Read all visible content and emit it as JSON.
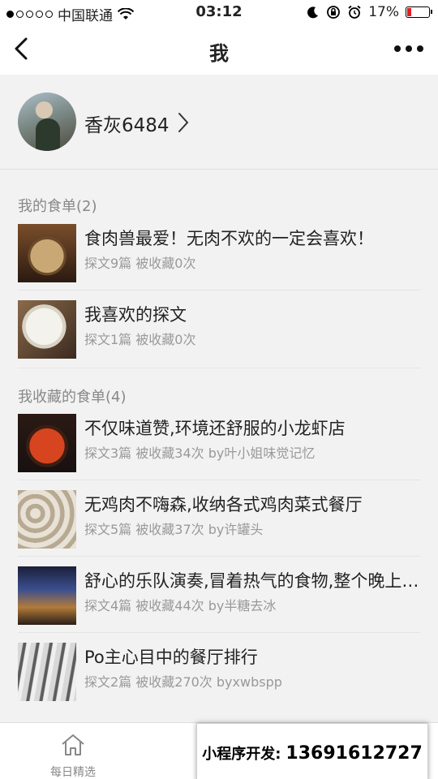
{
  "status_bar": {
    "carrier": "中国联通",
    "time": "03:12",
    "battery_percent": "17%",
    "battery_level": 0.17,
    "signal_bars_filled": 1,
    "signal_bars_total": 5,
    "icons": [
      "wifi-icon",
      "moon-icon",
      "orientation-lock-icon",
      "alarm-icon",
      "battery-icon"
    ]
  },
  "nav": {
    "title": "我",
    "back_icon": "chevron-left-icon",
    "more_icon": "more-icon"
  },
  "profile": {
    "name": "香灰6484",
    "chevron_icon": "chevron-right-icon"
  },
  "my_lists": {
    "header": "我的食单(2)",
    "items": [
      {
        "title": "食肉兽最爱！无肉不欢的一定会喜欢！",
        "meta": "探文9篇  被收藏0次"
      },
      {
        "title": "我喜欢的探文",
        "meta": "探文1篇  被收藏0次"
      }
    ]
  },
  "saved_lists": {
    "header": "我收藏的食单(4)",
    "items": [
      {
        "title": "不仅味道赞,环境还舒服的小龙虾店",
        "meta": "探文3篇  被收藏34次  by叶小姐味觉记忆"
      },
      {
        "title": "无鸡肉不嗨森,收纳各式鸡肉菜式餐厅",
        "meta": "探文5篇  被收藏37次  by许罐头"
      },
      {
        "title": "舒心的乐队演奏,冒着热气的食物,整个晚上都很愉快",
        "meta": "探文4篇  被收藏44次  by半糖去冰"
      },
      {
        "title": "Po主心目中的餐厅排行",
        "meta": "探文2篇  被收藏270次  byxwbspp"
      }
    ]
  },
  "tabbar": {
    "tab_label": "每日精选",
    "tab_icon": "home-icon"
  },
  "promo": {
    "label": "小程序开发:",
    "phone": "13691612727"
  }
}
